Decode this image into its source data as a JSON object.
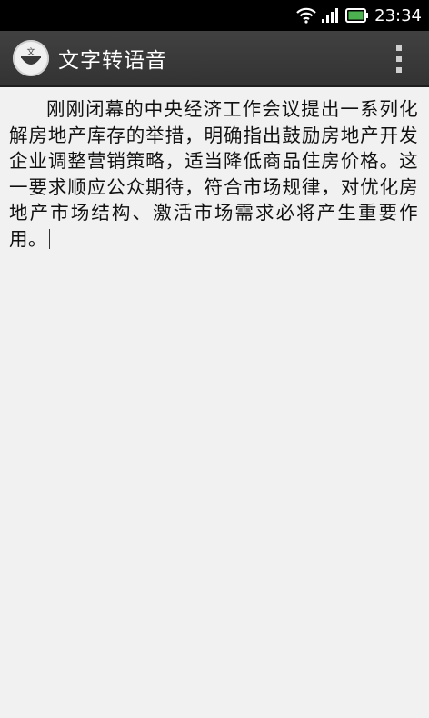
{
  "status_bar": {
    "time": "23:34",
    "icons": [
      "wifi-icon",
      "signal-icon",
      "battery-icon"
    ],
    "battery_color": "#4caf50"
  },
  "action_bar": {
    "app_icon": "app-logo-icon",
    "app_icon_text": "文",
    "title": "文字转语音",
    "overflow_icon": "overflow-menu-icon"
  },
  "editor": {
    "text": "刚刚闭幕的中央经济工作会议提出一系列化解房地产库存的举措，明确指出鼓励房地产开发企业调整营销策略，适当降低商品住房价格。这一要求顺应公众期待，符合市场规律，对优化房地产市场结构、激活市场需求必将产生重要作用。"
  },
  "colors": {
    "status_bar_bg": "#000000",
    "action_bar_bg": "#3a3a3a",
    "content_bg": "#f1f1f1",
    "text": "#111111"
  }
}
